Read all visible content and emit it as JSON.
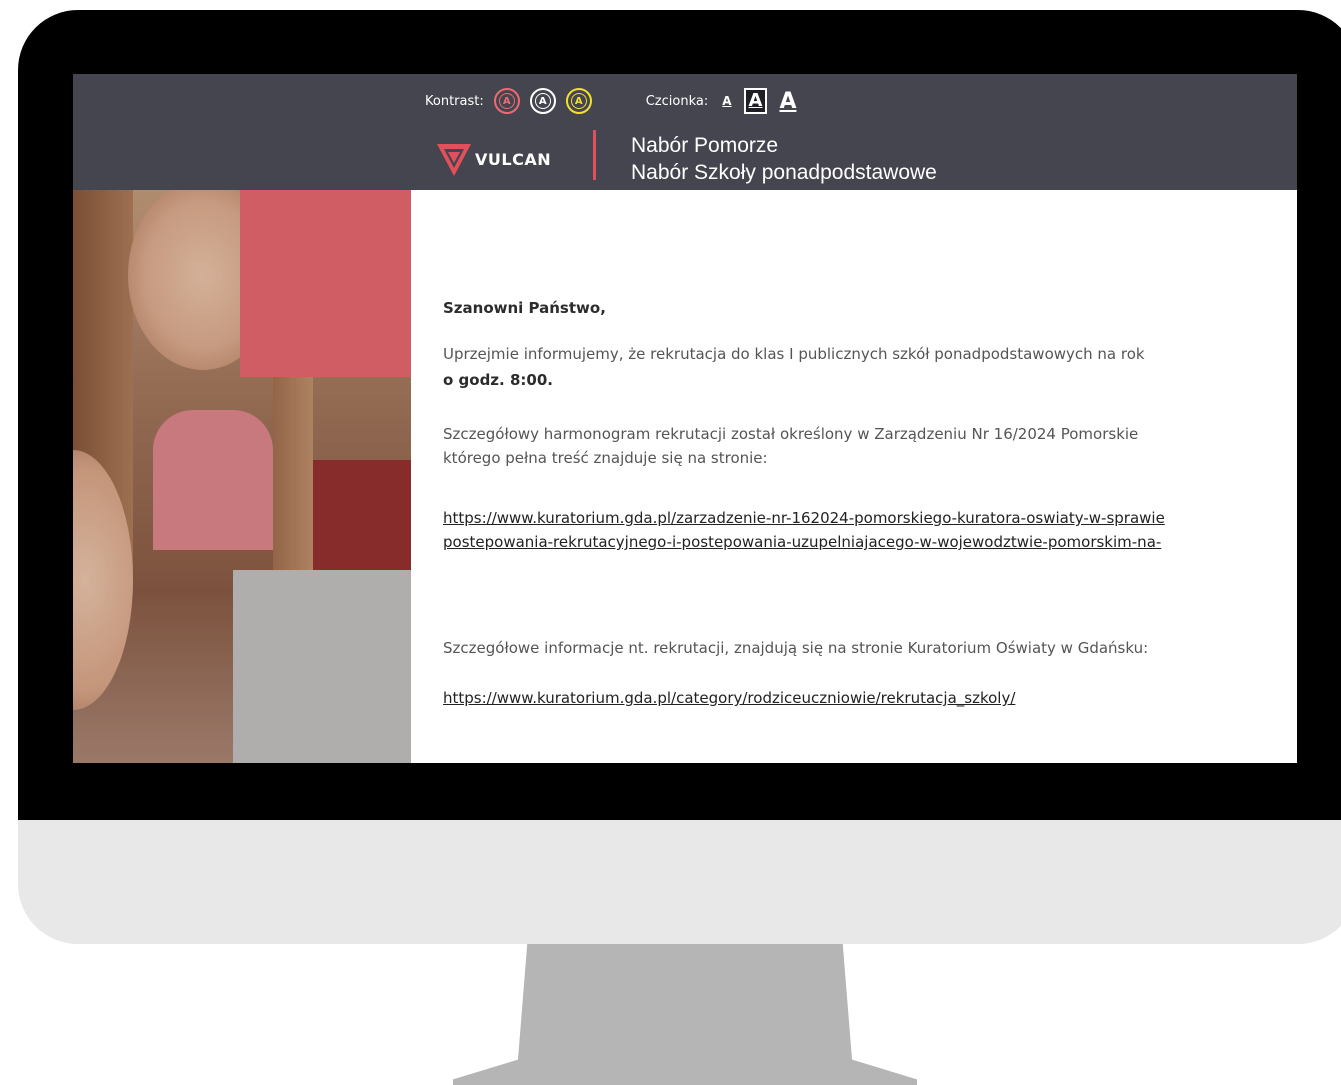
{
  "header": {
    "contrast_label": "Kontrast:",
    "contrast_options": [
      "A",
      "A",
      "A"
    ],
    "font_label": "Czcionka:",
    "font_options": [
      "A",
      "A",
      "A"
    ],
    "logo_text": "VULCAN",
    "title_line1": "Nabór Pomorze",
    "title_line2": "Nabór Szkoły ponadpodstawowe"
  },
  "content": {
    "greeting": "Szanowni Państwo,",
    "para1_line1": "Uprzejmie informujemy, że rekrutacja do klas I publicznych szkół ponadpodstawowych na rok",
    "para1_line2": "o godz. 8:00.",
    "para2_line1": "Szczegółowy harmonogram rekrutacji został określony w Zarządzeniu Nr 16/2024 Pomorskie",
    "para2_line2": "którego pełna treść znajduje się na stronie:",
    "link1_line1": "https://www.kuratorium.gda.pl/zarzadzenie-nr-162024-pomorskiego-kuratora-oswiaty-w-sprawie",
    "link1_line2": "postepowania-rekrutacyjnego-i-postepowania-uzupelniajacego-w-wojewodztwie-pomorskim-na-",
    "para3": "Szczegółowe informacje nt. rekrutacji, znajdują się na stronie Kuratorium Oświaty w Gdańsku:",
    "link2": "https://www.kuratorium.gda.pl/category/rodziceuczniowie/rekrutacja_szkoly/"
  },
  "colors": {
    "header_bg": "#45454f",
    "accent": "#ee6a72",
    "contrast_yellow": "#f2e12a"
  }
}
